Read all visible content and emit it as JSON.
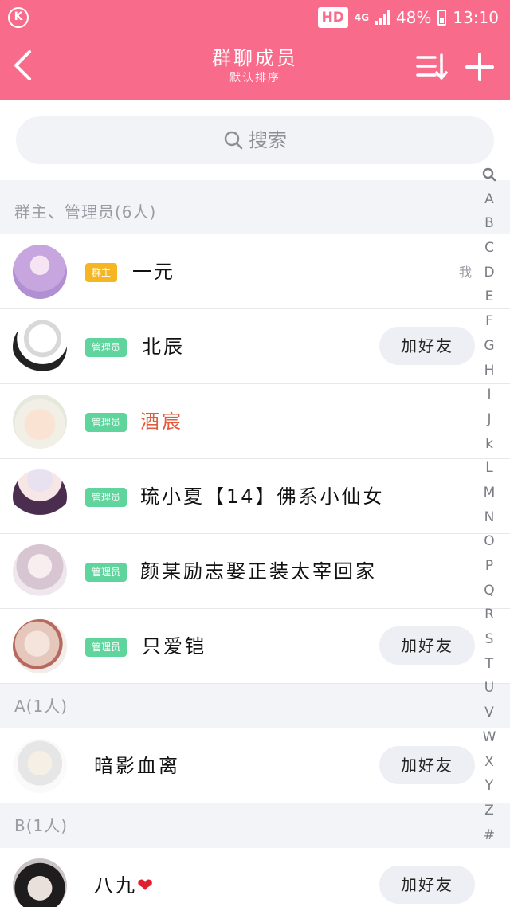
{
  "status_bar": {
    "app_icon_letter": "K",
    "hd_badge": "HD",
    "network": "4G",
    "battery": "48%",
    "time": "13:10"
  },
  "navbar": {
    "title": "群聊成员",
    "subtitle": "默认排序",
    "icons": {
      "back": "back-arrow-icon",
      "sort": "sort-icon",
      "add": "plus-icon"
    }
  },
  "search": {
    "placeholder": "搜索"
  },
  "sections": [
    {
      "header": "群主、管理员(6人)",
      "members": [
        {
          "tag": "群主",
          "tag_color": "#f6b523",
          "name": "一元",
          "me": "我"
        },
        {
          "tag": "管理员",
          "tag_color": "#5fd49d",
          "name": "北辰",
          "action": "加好友"
        },
        {
          "tag": "管理员",
          "tag_color": "#5fd49d",
          "name": "酒宸",
          "name_color": "#e35a3c"
        },
        {
          "tag": "管理员",
          "tag_color": "#5fd49d",
          "name": "琉小夏【14】佛系小仙女"
        },
        {
          "tag": "管理员",
          "tag_color": "#5fd49d",
          "name": "颜某励志娶正装太宰回家"
        },
        {
          "tag": "管理员",
          "tag_color": "#5fd49d",
          "name": "只爱铠",
          "action": "加好友"
        }
      ]
    },
    {
      "header": "A(1人)",
      "members": [
        {
          "name": "暗影血离",
          "action": "加好友"
        }
      ]
    },
    {
      "header": "B(1人)",
      "members": [
        {
          "name": "八九",
          "name_suffix": "❤",
          "action": "加好友"
        }
      ]
    }
  ],
  "index_bar": [
    "🔍",
    "A",
    "B",
    "C",
    "D",
    "E",
    "F",
    "G",
    "H",
    "I",
    "J",
    "k",
    "L",
    "M",
    "N",
    "O",
    "P",
    "Q",
    "R",
    "S",
    "T",
    "U",
    "V",
    "W",
    "X",
    "Y",
    "Z",
    "#"
  ],
  "colors": {
    "accent": "#f96b8b",
    "owner_tag": "#f6b523",
    "admin_tag": "#5fd49d"
  }
}
